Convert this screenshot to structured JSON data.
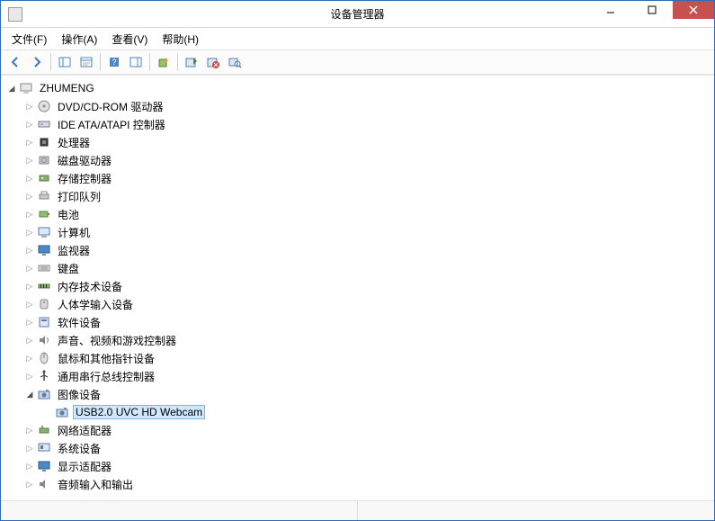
{
  "window": {
    "title": "设备管理器"
  },
  "menubar": [
    {
      "label": "文件(F)"
    },
    {
      "label": "操作(A)"
    },
    {
      "label": "查看(V)"
    },
    {
      "label": "帮助(H)"
    }
  ],
  "tree": {
    "root": {
      "label": "ZHUMENG",
      "expanded": true
    },
    "categories": [
      {
        "label": "DVD/CD-ROM 驱动器",
        "icon": "disc",
        "expanded": false
      },
      {
        "label": "IDE ATA/ATAPI 控制器",
        "icon": "ide",
        "expanded": false
      },
      {
        "label": "处理器",
        "icon": "cpu",
        "expanded": false
      },
      {
        "label": "磁盘驱动器",
        "icon": "disk",
        "expanded": false
      },
      {
        "label": "存储控制器",
        "icon": "storage",
        "expanded": false
      },
      {
        "label": "打印队列",
        "icon": "printer",
        "expanded": false
      },
      {
        "label": "电池",
        "icon": "battery",
        "expanded": false
      },
      {
        "label": "计算机",
        "icon": "computer",
        "expanded": false
      },
      {
        "label": "监视器",
        "icon": "monitor",
        "expanded": false
      },
      {
        "label": "键盘",
        "icon": "keyboard",
        "expanded": false
      },
      {
        "label": "内存技术设备",
        "icon": "memory",
        "expanded": false
      },
      {
        "label": "人体学输入设备",
        "icon": "hid",
        "expanded": false
      },
      {
        "label": "软件设备",
        "icon": "software",
        "expanded": false
      },
      {
        "label": "声音、视频和游戏控制器",
        "icon": "sound",
        "expanded": false
      },
      {
        "label": "鼠标和其他指针设备",
        "icon": "mouse",
        "expanded": false
      },
      {
        "label": "通用串行总线控制器",
        "icon": "usb",
        "expanded": false
      },
      {
        "label": "图像设备",
        "icon": "imaging",
        "expanded": true,
        "children": [
          {
            "label": "USB2.0 UVC HD Webcam",
            "icon": "camera",
            "selected": true
          }
        ]
      },
      {
        "label": "网络适配器",
        "icon": "network",
        "expanded": false
      },
      {
        "label": "系统设备",
        "icon": "system",
        "expanded": false
      },
      {
        "label": "显示适配器",
        "icon": "display",
        "expanded": false
      },
      {
        "label": "音频输入和输出",
        "icon": "audio",
        "expanded": false
      }
    ]
  }
}
